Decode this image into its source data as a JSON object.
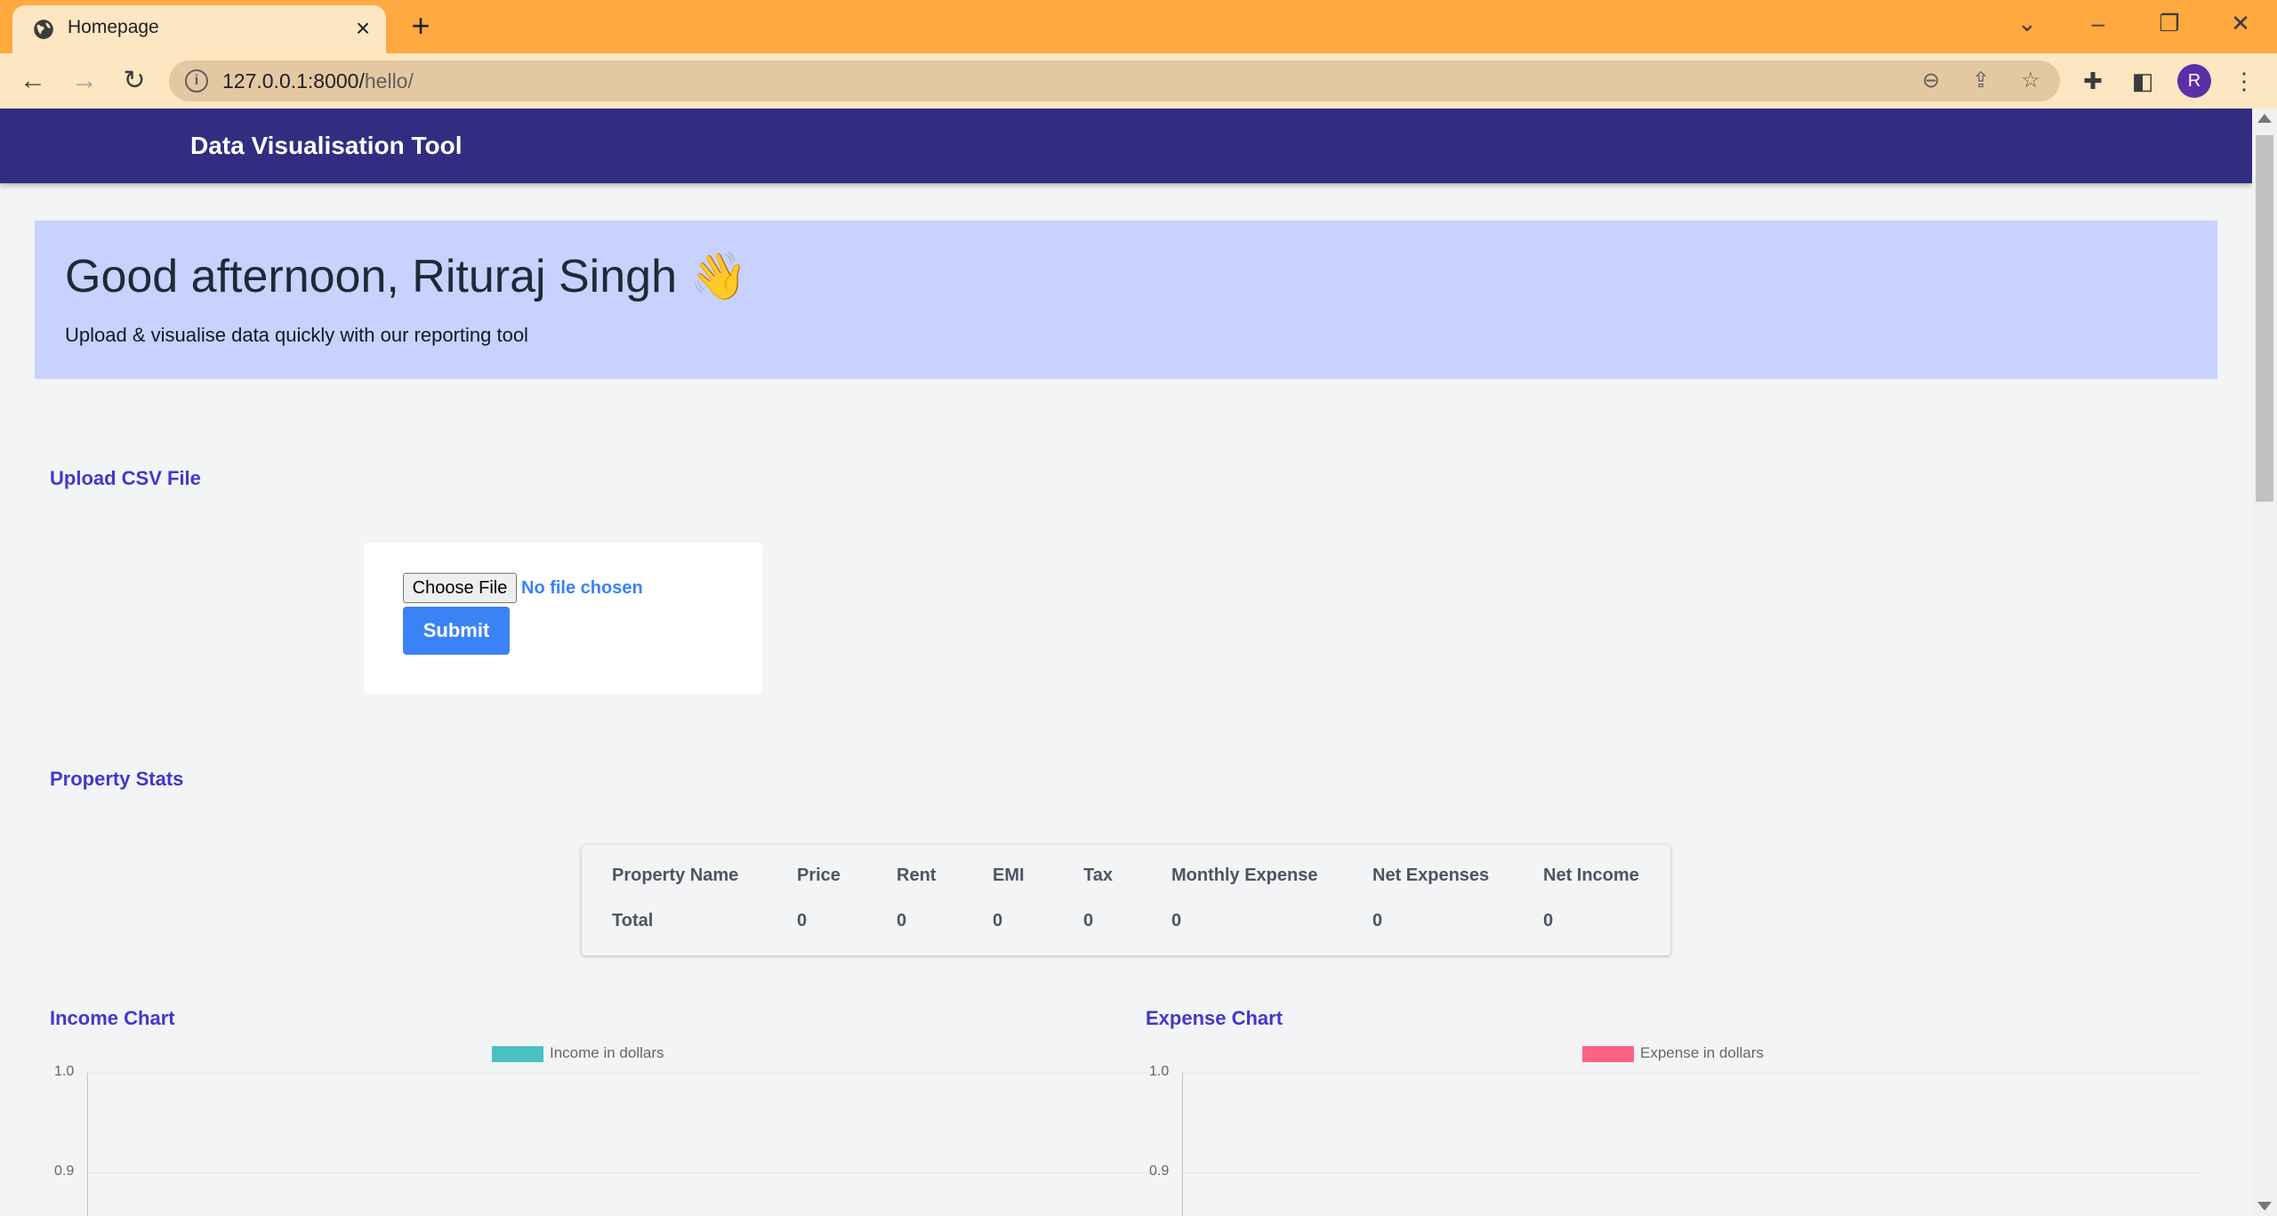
{
  "browser": {
    "tab_title": "Homepage",
    "url_host": "127.0.0.1:8000/",
    "url_path": "hello/",
    "profile_initial": "R"
  },
  "page": {
    "brand": "Data Visualisation Tool",
    "greeting": "Good afternoon, Rituraj Singh",
    "greeting_emoji": "👋",
    "subtitle": "Upload & visualise data quickly with our reporting tool",
    "upload": {
      "section_title": "Upload CSV File",
      "choose_label": "Choose File",
      "file_status": "No file chosen",
      "submit_label": "Submit"
    },
    "stats": {
      "section_title": "Property Stats",
      "columns": [
        "Property Name",
        "Price",
        "Rent",
        "EMI",
        "Tax",
        "Monthly Expense",
        "Net Expenses",
        "Net Income"
      ],
      "rows": [
        [
          "Total",
          "0",
          "0",
          "0",
          "0",
          "0",
          "0",
          "0"
        ]
      ]
    }
  },
  "chart_data": [
    {
      "type": "bar",
      "title": "Income Chart",
      "categories": [],
      "series": [
        {
          "name": "Income in dollars",
          "values": [],
          "color": "#4bc0c0"
        }
      ],
      "y_ticks": [
        "1.0",
        "0.9"
      ],
      "ylim": [
        0,
        1.0
      ]
    },
    {
      "type": "bar",
      "title": "Expense Chart",
      "categories": [],
      "series": [
        {
          "name": "Expense in dollars",
          "values": [],
          "color": "#ff6384"
        }
      ],
      "y_ticks": [
        "1.0",
        "0.9"
      ],
      "ylim": [
        0,
        1.0
      ]
    }
  ]
}
